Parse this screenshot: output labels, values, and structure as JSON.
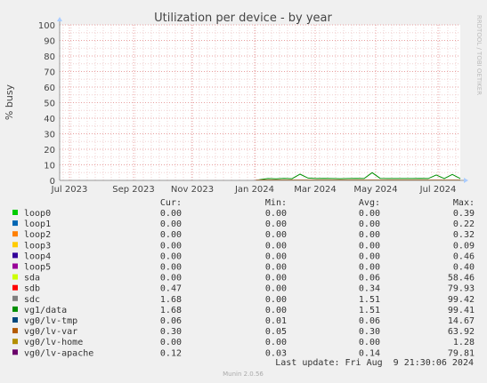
{
  "chart_data": {
    "type": "line",
    "title": "Utilization per device - by year",
    "ylabel": "% busy",
    "xlabel": "",
    "ylim": [
      0,
      100
    ],
    "yticks": [
      0,
      10,
      20,
      30,
      40,
      50,
      60,
      70,
      80,
      90,
      100
    ],
    "xtick_labels": [
      "Jul 2023",
      "Sep 2023",
      "Nov 2023",
      "Jan 2024",
      "Mar 2024",
      "May 2024",
      "Jul 2024"
    ],
    "grid": true,
    "watermark": "RRDTOOL / TOBI OETIKER",
    "legend_headers": [
      "Cur:",
      "Min:",
      "Avg:",
      "Max:"
    ],
    "series": [
      {
        "name": "loop0",
        "color": "#00cc00",
        "cur": "0.00",
        "min": "0.00",
        "avg": "0.00",
        "max": "0.39"
      },
      {
        "name": "loop1",
        "color": "#0066b3",
        "cur": "0.00",
        "min": "0.00",
        "avg": "0.00",
        "max": "0.22"
      },
      {
        "name": "loop2",
        "color": "#ff8000",
        "cur": "0.00",
        "min": "0.00",
        "avg": "0.00",
        "max": "0.32"
      },
      {
        "name": "loop3",
        "color": "#ffcc00",
        "cur": "0.00",
        "min": "0.00",
        "avg": "0.00",
        "max": "0.09"
      },
      {
        "name": "loop4",
        "color": "#330099",
        "cur": "0.00",
        "min": "0.00",
        "avg": "0.00",
        "max": "0.46"
      },
      {
        "name": "loop5",
        "color": "#990099",
        "cur": "0.00",
        "min": "0.00",
        "avg": "0.00",
        "max": "0.40"
      },
      {
        "name": "sda",
        "color": "#ccff00",
        "cur": "0.00",
        "min": "0.00",
        "avg": "0.06",
        "max": "58.46"
      },
      {
        "name": "sdb",
        "color": "#ff0000",
        "cur": "0.47",
        "min": "0.00",
        "avg": "0.34",
        "max": "79.93"
      },
      {
        "name": "sdc",
        "color": "#808080",
        "cur": "1.68",
        "min": "0.00",
        "avg": "1.51",
        "max": "99.42"
      },
      {
        "name": "vg1/data",
        "color": "#008f00",
        "cur": "1.68",
        "min": "0.00",
        "avg": "1.51",
        "max": "99.41"
      },
      {
        "name": "vg0/lv-tmp",
        "color": "#00487d",
        "cur": "0.06",
        "min": "0.01",
        "avg": "0.06",
        "max": "14.67"
      },
      {
        "name": "vg0/lv-var",
        "color": "#b35a00",
        "cur": "0.30",
        "min": "0.05",
        "avg": "0.30",
        "max": "63.92"
      },
      {
        "name": "vg0/lv-home",
        "color": "#b38f00",
        "cur": "0.00",
        "min": "0.00",
        "avg": "0.00",
        "max": "1.28"
      },
      {
        "name": "vg0/lv-apache",
        "color": "#6b006b",
        "cur": "0.12",
        "min": "0.03",
        "avg": "0.14",
        "max": "79.81"
      }
    ],
    "data_series": {
      "name": "vg1/data",
      "color": "#008f00",
      "x": [
        0.0,
        0.49,
        0.5,
        0.52,
        0.54,
        0.56,
        0.58,
        0.6,
        0.62,
        0.64,
        0.66,
        0.68,
        0.7,
        0.72,
        0.74,
        0.76,
        0.78,
        0.8,
        0.82,
        0.84,
        0.86,
        0.88,
        0.9,
        0.92,
        0.94,
        0.96,
        0.98,
        1.0
      ],
      "y": [
        0,
        0,
        0.5,
        1.2,
        1.0,
        1.3,
        1.1,
        4.0,
        1.5,
        1.2,
        1.3,
        1.2,
        1.1,
        1.2,
        1.3,
        1.2,
        5.0,
        1.3,
        1.2,
        1.2,
        1.2,
        1.2,
        1.3,
        1.2,
        3.5,
        1.2,
        3.8,
        1.2
      ]
    }
  },
  "footer": {
    "last_update": "Last update: Fri Aug  9 21:30:06 2024",
    "munin_version": "Munin 2.0.56"
  }
}
